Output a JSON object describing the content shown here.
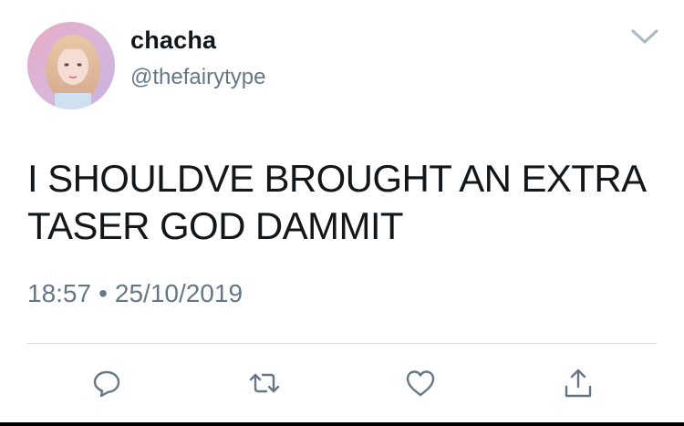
{
  "tweet": {
    "display_name": "chacha",
    "handle": "@thefairytype",
    "text_lines": [
      "I SHOULDVE BROUGHT AN EXTRA",
      "TASER GOD DAMMIT"
    ],
    "time": "18:57",
    "separator": "•",
    "date": "25/10/2019"
  },
  "icons": {
    "menu": "chevron-down-icon",
    "reply": "reply-icon",
    "retweet": "retweet-icon",
    "like": "heart-icon",
    "share": "share-icon"
  },
  "colors": {
    "text_primary": "#14171a",
    "text_secondary": "#657786",
    "icon": "#657786",
    "divider": "#d4dbe0"
  }
}
